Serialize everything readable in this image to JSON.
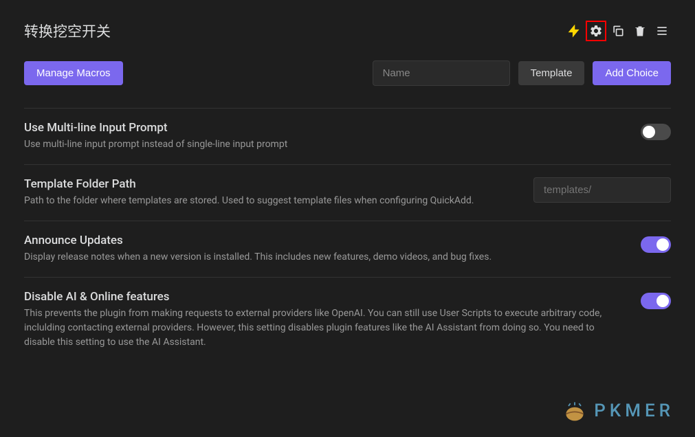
{
  "header": {
    "title": "转换挖空开关"
  },
  "actions": {
    "manage_macros": "Manage Macros",
    "name_placeholder": "Name",
    "template": "Template",
    "add_choice": "Add Choice"
  },
  "settings": [
    {
      "title": "Use Multi-line Input Prompt",
      "desc": "Use multi-line input prompt instead of single-line input prompt",
      "control": "toggle",
      "value": false
    },
    {
      "title": "Template Folder Path",
      "desc": "Path to the folder where templates are stored. Used to suggest template files when configuring QuickAdd.",
      "control": "text",
      "placeholder": "templates/"
    },
    {
      "title": "Announce Updates",
      "desc": "Display release notes when a new version is installed. This includes new features, demo videos, and bug fixes.",
      "control": "toggle",
      "value": true
    },
    {
      "title": "Disable AI & Online features",
      "desc": "This prevents the plugin from making requests to external providers like OpenAI. You can still use User Scripts to execute arbitrary code, inclulding contacting external providers. However, this setting disables plugin features like the AI Assistant from doing so. You need to disable this setting to use the AI Assistant.",
      "control": "toggle",
      "value": true
    }
  ],
  "watermark": {
    "text": "PKMER"
  }
}
